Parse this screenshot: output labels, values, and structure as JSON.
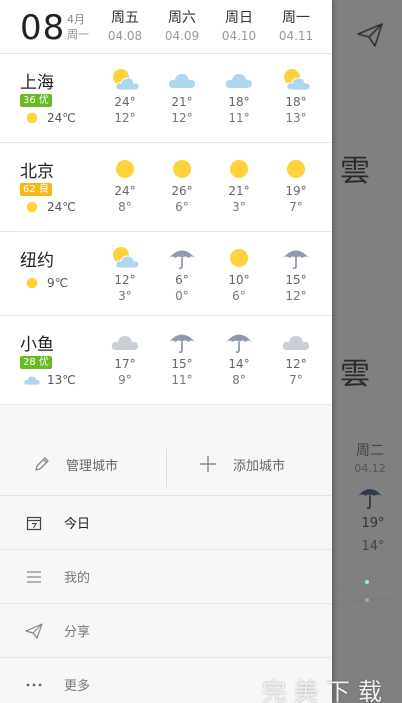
{
  "header": {
    "day": "08",
    "month": "4月",
    "weekday": "周一",
    "forecast_days": [
      {
        "weekday": "周五",
        "date": "04.08"
      },
      {
        "weekday": "周六",
        "date": "04.09"
      },
      {
        "weekday": "周日",
        "date": "04.10"
      },
      {
        "weekday": "周一",
        "date": "04.11"
      }
    ]
  },
  "cities": [
    {
      "name": "上海",
      "aqi": {
        "label": "36 优",
        "color": "#66bb22"
      },
      "current": {
        "icon": "sun-icon",
        "temp": "24℃"
      },
      "forecast": [
        {
          "icon": "partly-cloudy-icon",
          "hi": "24°",
          "lo": "12°"
        },
        {
          "icon": "cloud-icon",
          "hi": "21°",
          "lo": "12°"
        },
        {
          "icon": "cloud-icon",
          "hi": "18°",
          "lo": "11°"
        },
        {
          "icon": "partly-cloudy-icon",
          "hi": "18°",
          "lo": "13°"
        }
      ]
    },
    {
      "name": "北京",
      "aqi": {
        "label": "62 良",
        "color": "#f2b81a"
      },
      "current": {
        "icon": "sun-icon",
        "temp": "24℃"
      },
      "forecast": [
        {
          "icon": "sun-icon",
          "hi": "24°",
          "lo": "8°"
        },
        {
          "icon": "sun-icon",
          "hi": "26°",
          "lo": "6°"
        },
        {
          "icon": "sun-icon",
          "hi": "21°",
          "lo": "3°"
        },
        {
          "icon": "sun-icon",
          "hi": "19°",
          "lo": "7°"
        }
      ]
    },
    {
      "name": "纽约",
      "aqi": null,
      "current": {
        "icon": "sun-icon",
        "temp": "9℃"
      },
      "forecast": [
        {
          "icon": "partly-cloudy-icon",
          "hi": "12°",
          "lo": "3°"
        },
        {
          "icon": "umbrella-icon",
          "hi": "6°",
          "lo": "0°"
        },
        {
          "icon": "sun-icon",
          "hi": "10°",
          "lo": "6°"
        },
        {
          "icon": "umbrella-icon",
          "hi": "15°",
          "lo": "12°"
        }
      ]
    },
    {
      "name": "小鱼",
      "aqi": {
        "label": "28 优",
        "color": "#66bb22"
      },
      "current": {
        "icon": "cloud-icon",
        "temp": "13℃"
      },
      "forecast": [
        {
          "icon": "cloud-gray-icon",
          "hi": "17°",
          "lo": "9°"
        },
        {
          "icon": "umbrella-icon",
          "hi": "15°",
          "lo": "11°"
        },
        {
          "icon": "umbrella-icon",
          "hi": "14°",
          "lo": "8°"
        },
        {
          "icon": "cloud-gray-icon",
          "hi": "12°",
          "lo": "7°"
        }
      ]
    }
  ],
  "actions": {
    "manage_label": "管理城市",
    "add_label": "添加城市"
  },
  "menu": [
    {
      "icon": "calendar-icon",
      "label": "今日"
    },
    {
      "icon": "menu-lines-icon",
      "label": "我的"
    },
    {
      "icon": "paper-plane-icon",
      "label": "分享"
    },
    {
      "icon": "more-dots-icon",
      "label": "更多"
    }
  ],
  "background": {
    "glyph": "雲",
    "day_weekday": "周二",
    "day_date": "04.12",
    "hi": "19°",
    "lo": "14°"
  },
  "watermark": "完美下载",
  "colors": {
    "sun": "#fdd23a",
    "cloud": "#aed6ee",
    "cloud_gray": "#c9cfd6",
    "umbrella": "#8e99ad"
  }
}
